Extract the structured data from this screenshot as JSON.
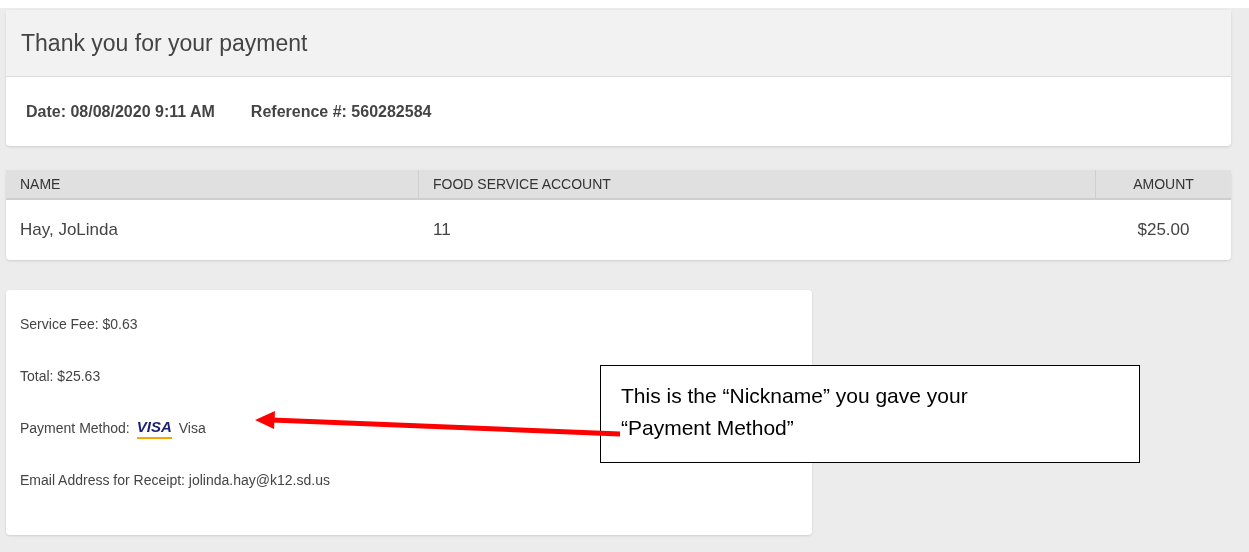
{
  "title": "Thank you for your payment",
  "date": "Date: 08/08/2020 9:11 AM",
  "reference": "Reference #: 560282584",
  "table": {
    "columns": [
      "NAME",
      "FOOD SERVICE ACCOUNT",
      "AMOUNT"
    ],
    "rows": [
      [
        "Hay, JoLinda",
        "11",
        "$25.00"
      ]
    ]
  },
  "summary": {
    "service_fee": "Service Fee: $0.63",
    "total": "Total: $25.63",
    "payment_label": "Payment Method:",
    "card_brand": "VISA",
    "payment_nickname": "Visa",
    "email": "Email Address for Receipt: jolinda.hay@k12.sd.us"
  },
  "callout": {
    "text": "This is the “Nickname” you gave your “Payment Method”"
  }
}
